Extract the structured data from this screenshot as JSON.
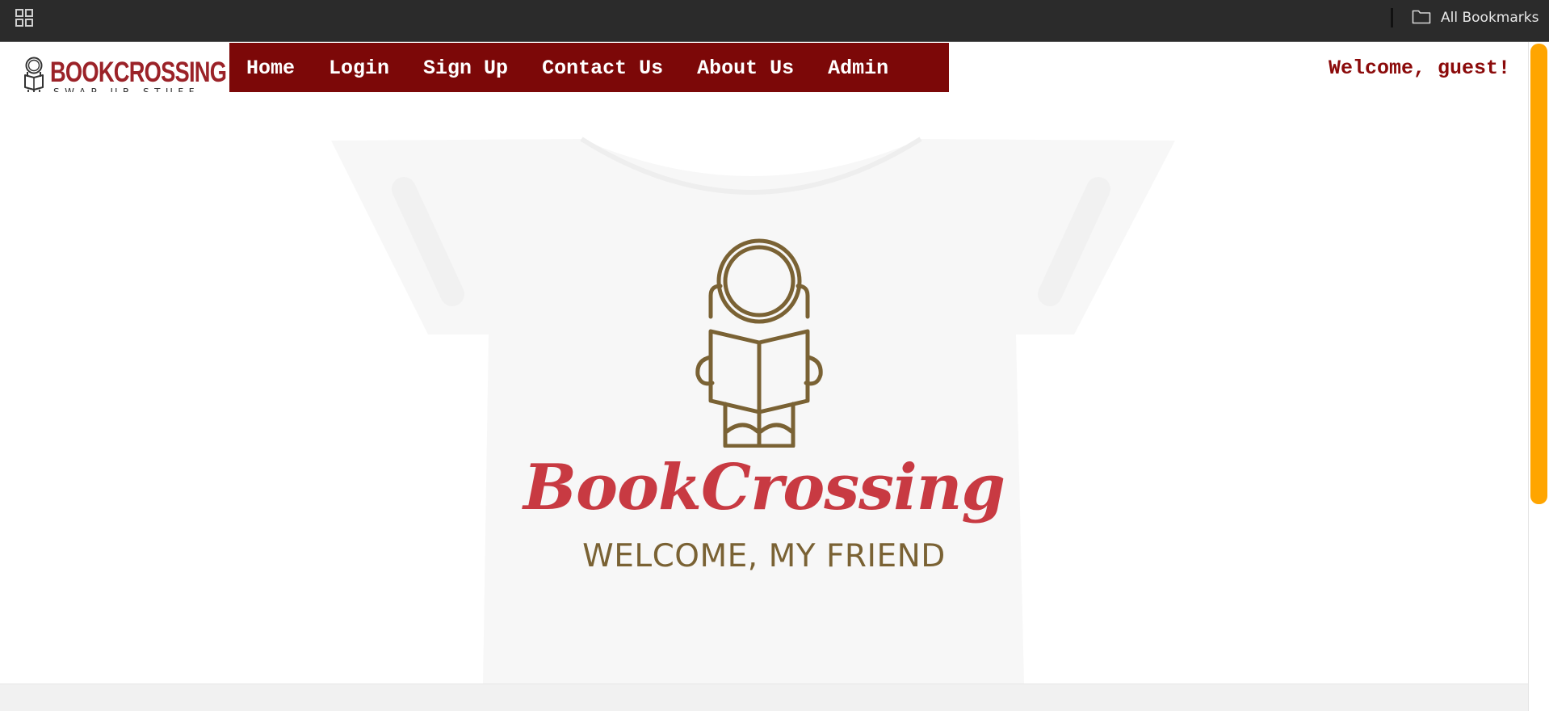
{
  "browser": {
    "apps_icon": "apps-grid-icon",
    "bookmarks_icon": "folder-icon",
    "all_bookmarks_label": "All Bookmarks"
  },
  "site": {
    "logo_title": "BOOKCROSSING",
    "logo_subtitle": "SWAP UR STUFF",
    "welcome_text": "Welcome, guest!",
    "nav": [
      {
        "label": "Home"
      },
      {
        "label": "Login"
      },
      {
        "label": "Sign Up"
      },
      {
        "label": "Contact Us"
      },
      {
        "label": "About Us"
      },
      {
        "label": "Admin"
      }
    ]
  },
  "hero": {
    "title": "BookCrossing",
    "subtitle": "WELCOME, MY FRIEND",
    "emblem_icon": "astronaut-reading-icon"
  },
  "colors": {
    "nav_bg": "#7c0808",
    "brand_red": "#9b2228",
    "hero_red": "#c83a42",
    "hero_brown": "#7a6234",
    "scroll_thumb": "#ffa500"
  }
}
